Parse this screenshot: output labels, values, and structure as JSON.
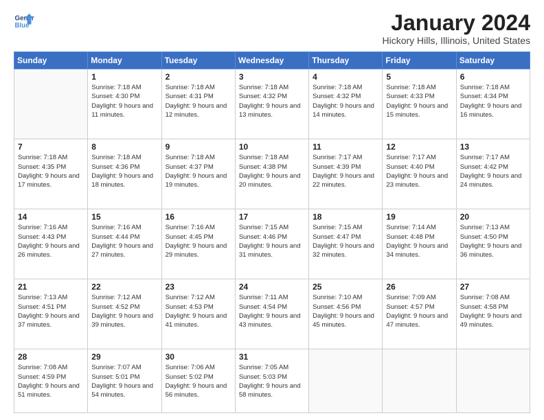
{
  "header": {
    "logo_line1": "General",
    "logo_line2": "Blue",
    "title": "January 2024",
    "location": "Hickory Hills, Illinois, United States"
  },
  "days_of_week": [
    "Sunday",
    "Monday",
    "Tuesday",
    "Wednesday",
    "Thursday",
    "Friday",
    "Saturday"
  ],
  "weeks": [
    [
      {
        "day": "",
        "info": ""
      },
      {
        "day": "1",
        "info": "Sunrise: 7:18 AM\nSunset: 4:30 PM\nDaylight: 9 hours\nand 11 minutes."
      },
      {
        "day": "2",
        "info": "Sunrise: 7:18 AM\nSunset: 4:31 PM\nDaylight: 9 hours\nand 12 minutes."
      },
      {
        "day": "3",
        "info": "Sunrise: 7:18 AM\nSunset: 4:32 PM\nDaylight: 9 hours\nand 13 minutes."
      },
      {
        "day": "4",
        "info": "Sunrise: 7:18 AM\nSunset: 4:32 PM\nDaylight: 9 hours\nand 14 minutes."
      },
      {
        "day": "5",
        "info": "Sunrise: 7:18 AM\nSunset: 4:33 PM\nDaylight: 9 hours\nand 15 minutes."
      },
      {
        "day": "6",
        "info": "Sunrise: 7:18 AM\nSunset: 4:34 PM\nDaylight: 9 hours\nand 16 minutes."
      }
    ],
    [
      {
        "day": "7",
        "info": "Sunrise: 7:18 AM\nSunset: 4:35 PM\nDaylight: 9 hours\nand 17 minutes."
      },
      {
        "day": "8",
        "info": "Sunrise: 7:18 AM\nSunset: 4:36 PM\nDaylight: 9 hours\nand 18 minutes."
      },
      {
        "day": "9",
        "info": "Sunrise: 7:18 AM\nSunset: 4:37 PM\nDaylight: 9 hours\nand 19 minutes."
      },
      {
        "day": "10",
        "info": "Sunrise: 7:18 AM\nSunset: 4:38 PM\nDaylight: 9 hours\nand 20 minutes."
      },
      {
        "day": "11",
        "info": "Sunrise: 7:17 AM\nSunset: 4:39 PM\nDaylight: 9 hours\nand 22 minutes."
      },
      {
        "day": "12",
        "info": "Sunrise: 7:17 AM\nSunset: 4:40 PM\nDaylight: 9 hours\nand 23 minutes."
      },
      {
        "day": "13",
        "info": "Sunrise: 7:17 AM\nSunset: 4:42 PM\nDaylight: 9 hours\nand 24 minutes."
      }
    ],
    [
      {
        "day": "14",
        "info": "Sunrise: 7:16 AM\nSunset: 4:43 PM\nDaylight: 9 hours\nand 26 minutes."
      },
      {
        "day": "15",
        "info": "Sunrise: 7:16 AM\nSunset: 4:44 PM\nDaylight: 9 hours\nand 27 minutes."
      },
      {
        "day": "16",
        "info": "Sunrise: 7:16 AM\nSunset: 4:45 PM\nDaylight: 9 hours\nand 29 minutes."
      },
      {
        "day": "17",
        "info": "Sunrise: 7:15 AM\nSunset: 4:46 PM\nDaylight: 9 hours\nand 31 minutes."
      },
      {
        "day": "18",
        "info": "Sunrise: 7:15 AM\nSunset: 4:47 PM\nDaylight: 9 hours\nand 32 minutes."
      },
      {
        "day": "19",
        "info": "Sunrise: 7:14 AM\nSunset: 4:48 PM\nDaylight: 9 hours\nand 34 minutes."
      },
      {
        "day": "20",
        "info": "Sunrise: 7:13 AM\nSunset: 4:50 PM\nDaylight: 9 hours\nand 36 minutes."
      }
    ],
    [
      {
        "day": "21",
        "info": "Sunrise: 7:13 AM\nSunset: 4:51 PM\nDaylight: 9 hours\nand 37 minutes."
      },
      {
        "day": "22",
        "info": "Sunrise: 7:12 AM\nSunset: 4:52 PM\nDaylight: 9 hours\nand 39 minutes."
      },
      {
        "day": "23",
        "info": "Sunrise: 7:12 AM\nSunset: 4:53 PM\nDaylight: 9 hours\nand 41 minutes."
      },
      {
        "day": "24",
        "info": "Sunrise: 7:11 AM\nSunset: 4:54 PM\nDaylight: 9 hours\nand 43 minutes."
      },
      {
        "day": "25",
        "info": "Sunrise: 7:10 AM\nSunset: 4:56 PM\nDaylight: 9 hours\nand 45 minutes."
      },
      {
        "day": "26",
        "info": "Sunrise: 7:09 AM\nSunset: 4:57 PM\nDaylight: 9 hours\nand 47 minutes."
      },
      {
        "day": "27",
        "info": "Sunrise: 7:08 AM\nSunset: 4:58 PM\nDaylight: 9 hours\nand 49 minutes."
      }
    ],
    [
      {
        "day": "28",
        "info": "Sunrise: 7:08 AM\nSunset: 4:59 PM\nDaylight: 9 hours\nand 51 minutes."
      },
      {
        "day": "29",
        "info": "Sunrise: 7:07 AM\nSunset: 5:01 PM\nDaylight: 9 hours\nand 54 minutes."
      },
      {
        "day": "30",
        "info": "Sunrise: 7:06 AM\nSunset: 5:02 PM\nDaylight: 9 hours\nand 56 minutes."
      },
      {
        "day": "31",
        "info": "Sunrise: 7:05 AM\nSunset: 5:03 PM\nDaylight: 9 hours\nand 58 minutes."
      },
      {
        "day": "",
        "info": ""
      },
      {
        "day": "",
        "info": ""
      },
      {
        "day": "",
        "info": ""
      }
    ]
  ]
}
